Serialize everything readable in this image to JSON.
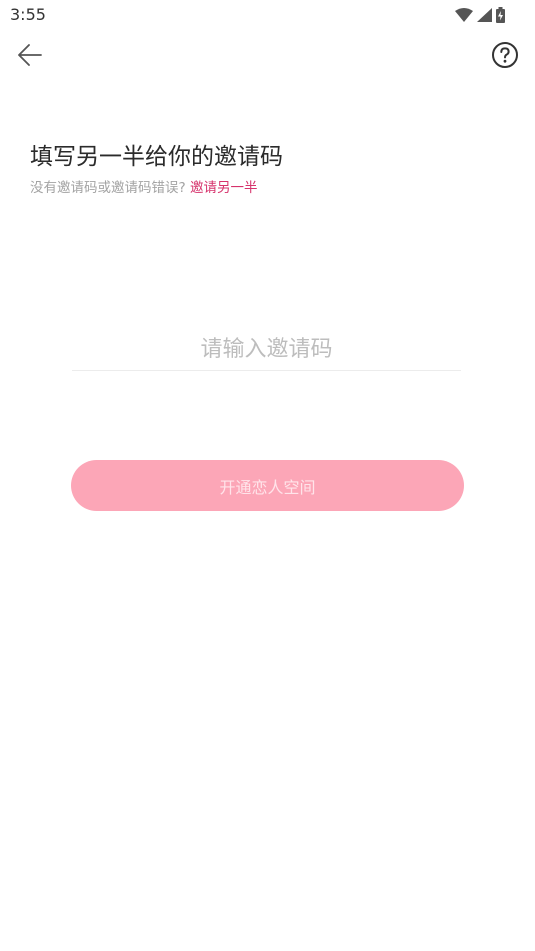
{
  "status_bar": {
    "time": "3:55",
    "icons": [
      "wifi-icon",
      "signal-icon",
      "battery-charging-icon"
    ]
  },
  "nav": {
    "back_icon": "arrow-left-icon",
    "help_icon": "help-circle-icon"
  },
  "main": {
    "title": "填写另一半给你的邀请码",
    "subtitle_text": "没有邀请码或邀请码错误? ",
    "invite_link": "邀请另一半",
    "input_value": "",
    "input_placeholder": "请输入邀请码",
    "submit_label": "开通恋人空间"
  },
  "colors": {
    "accent_link": "#d6336c",
    "button_bg": "#fca6b7",
    "button_text": "#ffe4ea"
  }
}
